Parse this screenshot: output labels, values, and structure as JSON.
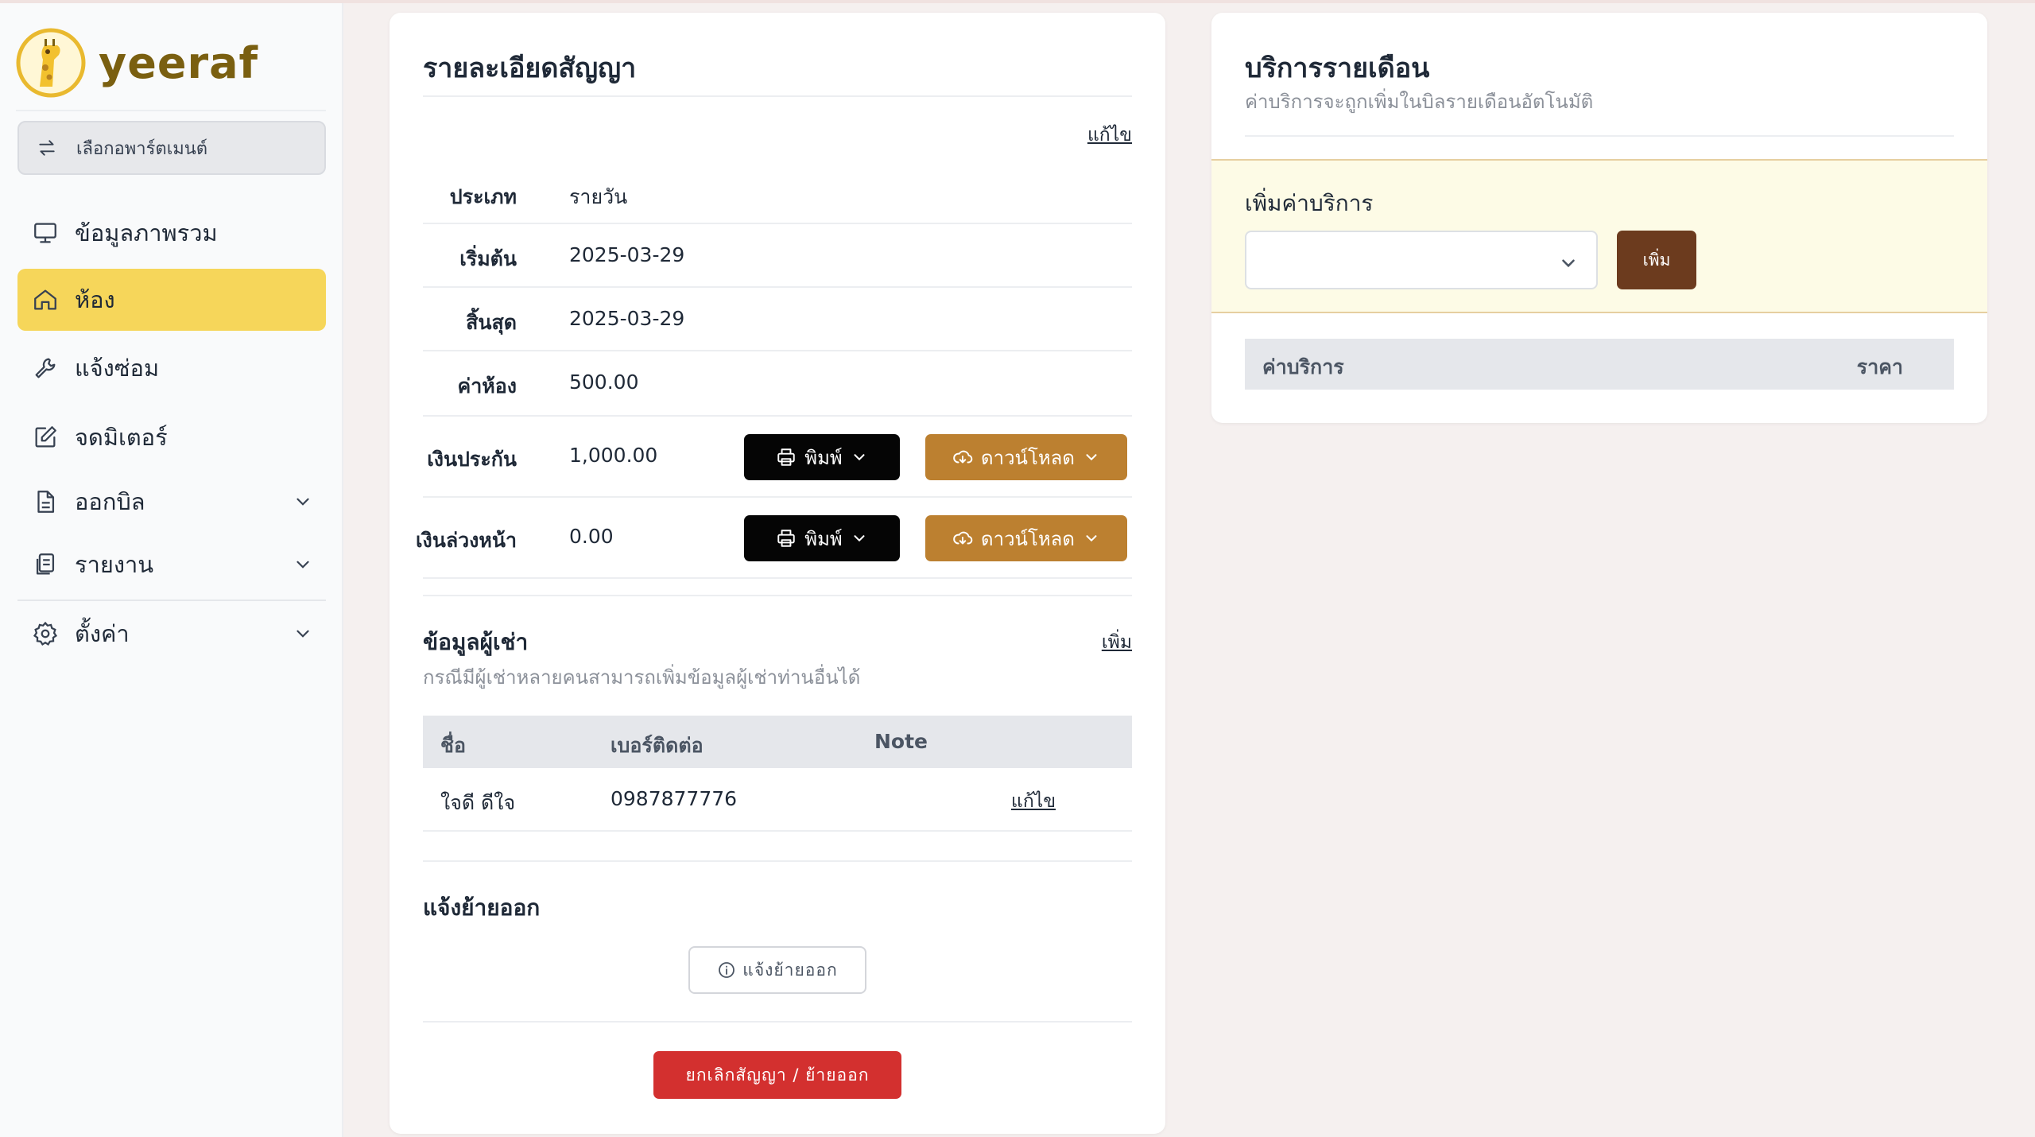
{
  "brand": {
    "name": "yeeraf"
  },
  "sidebar": {
    "apartment_select": "เลือกอพาร์ตเมนต์",
    "items": [
      {
        "label": "ข้อมูลภาพรวม",
        "icon": "monitor-icon"
      },
      {
        "label": "ห้อง",
        "icon": "home-icon",
        "active": true
      },
      {
        "label": "แจ้งซ่อม",
        "icon": "wrench-icon"
      },
      {
        "label": "จดมิเตอร์",
        "icon": "edit-icon"
      },
      {
        "label": "ออกบิล",
        "icon": "document-icon",
        "expandable": true
      },
      {
        "label": "รายงาน",
        "icon": "clipboard-icon",
        "expandable": true
      },
      {
        "label": "ตั้งค่า",
        "icon": "gear-icon",
        "expandable": true
      }
    ]
  },
  "contract": {
    "title": "รายละเอียดสัญญา",
    "edit_link": "แก้ไข",
    "rows": [
      {
        "label": "ประเภท",
        "value": "รายวัน"
      },
      {
        "label": "เริ่มต้น",
        "value": "2025-03-29"
      },
      {
        "label": "สิ้นสุด",
        "value": "2025-03-29"
      },
      {
        "label": "ค่าห้อง",
        "value": "500.00"
      },
      {
        "label": "เงินประกัน",
        "value": "1,000.00"
      },
      {
        "label": "เงินล่วงหน้า",
        "value": "0.00"
      }
    ],
    "print_label": "พิมพ์",
    "download_label": "ดาวน์โหลด"
  },
  "tenants": {
    "title": "ข้อมูลผู้เช่า",
    "add_link": "เพิ่ม",
    "subtitle": "กรณีมีผู้เช่าหลายคนสามารถเพิ่มข้อมูลผู้เช่าท่านอื่นได้",
    "columns": [
      "ชื่อ",
      "เบอร์ติดต่อ",
      "Note"
    ],
    "rows": [
      {
        "name": "ใจดี ดีใจ",
        "phone": "0987877776",
        "note": "",
        "edit": "แก้ไข"
      }
    ]
  },
  "moveout": {
    "title": "แจ้งย้ายออก",
    "button": "แจ้งย้ายออก",
    "cancel_button": "ยกเลิกสัญญา / ย้ายออก"
  },
  "services": {
    "title": "บริการรายเดือน",
    "subtitle": "ค่าบริการจะถูกเพิ่มในบิลรายเดือนอัตโนมัติ",
    "add_title": "เพิ่มค่าบริการ",
    "select_value": "",
    "add_button": "เพิ่ม",
    "columns": [
      "ค่าบริการ",
      "ราคา"
    ]
  },
  "colors": {
    "accent_yellow": "#f6d65a",
    "download_orange": "#bc8030",
    "add_brown": "#6c3b1e",
    "danger_red": "#d3302f"
  }
}
